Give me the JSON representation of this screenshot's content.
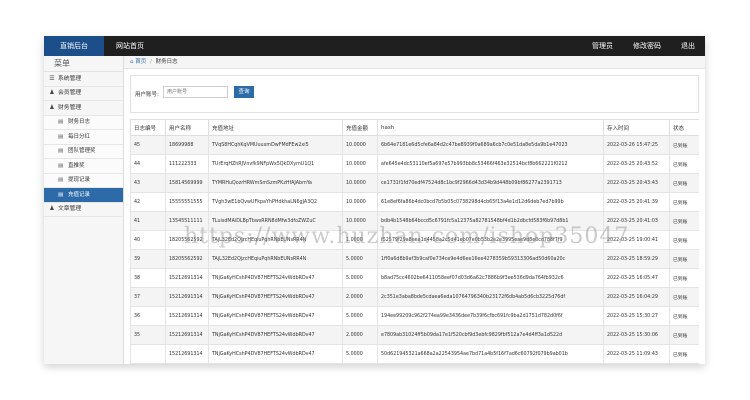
{
  "topbar": {
    "brand": "直销后台",
    "nav": "网站首页",
    "right": [
      "管理员",
      "修改密码",
      "退出"
    ]
  },
  "sidebar": {
    "title": "菜单",
    "items": [
      {
        "label": "系统管理",
        "icon": "list-icon"
      },
      {
        "label": "会员管理",
        "icon": "user-icon"
      },
      {
        "label": "财务管理",
        "icon": "user-icon"
      }
    ],
    "subitems": [
      {
        "label": "财务日志",
        "icon": "file-icon"
      },
      {
        "label": "每日分红",
        "icon": "file-icon"
      },
      {
        "label": "团队管理奖",
        "icon": "file-icon"
      },
      {
        "label": "直推奖",
        "icon": "file-icon"
      },
      {
        "label": "提现记录",
        "icon": "file-icon"
      },
      {
        "label": "充值记录",
        "icon": "file-icon",
        "active": true
      }
    ],
    "after": [
      {
        "label": "文章管理",
        "icon": "user-icon"
      }
    ]
  },
  "breadcrumb": {
    "home": "首页",
    "sep": "/",
    "current": "财务日志"
  },
  "search": {
    "label": "用户账号:",
    "placeholder": "用户账号",
    "button": "查询"
  },
  "table": {
    "headers": [
      "日志编号",
      "用户名称",
      "充值地址",
      "充值金额",
      "hash",
      "存入时间",
      "状态"
    ],
    "rows": [
      [
        "45",
        "18699988",
        "TVqS8HCqhKqVMUuuxmDwFMdFEw2xi5",
        "10.0000",
        "6b64e7181e6d5cfe6a84d2c47be8939f0a689a6cb7c0e51da8e5da9b1e47023",
        "2022-03-26 15:47:25",
        "已到账"
      ],
      [
        "44",
        "111222333",
        "TUrErqHZhRJVnvfk9NFpWx5QkDXymU1Q1",
        "10.0000",
        "afe645e4dc53110ef5a697e57b993bb8c53466f463e32514bcf8b662221f0212",
        "2022-03-25 20:43:52",
        "已到账"
      ],
      [
        "43",
        "15814569999",
        "TYMRHuQozrHRWmSmSzmPKzHfAJAbmYa",
        "10.0000",
        "ce1731f1fd70edf47524d8c1bc9f2966d43d34b9d448b09bf86277a2391713",
        "2022-03-25 20:43:43",
        "已到账"
      ],
      [
        "42",
        "15555551555",
        "TVgh3wE1bQvwUFkpaYhPHdkhaLN6gJA3Q2",
        "10.0000",
        "61e8ef6fa86b4dc0bcd7b5b05c0738298d4cb65f13a4e1d12d6deb7ed7b99b",
        "2022-03-25 20:41:39",
        "已到账"
      ],
      [
        "41",
        "13545511111",
        "TLuisdMAiDLBpTbwsRRN8dMfw3dfoZWZuC",
        "10.0000",
        "bdb4b1548b64bccd5c6791fc5a12375a82781548bf4d1b2dbcfd583f6b97d8b1",
        "2022-03-25 20:41:03",
        "已到账"
      ],
      [
        "40",
        "18205562592",
        "TAjL32Ed2QjzcHEqiuPqhRNbEUNsRR4N",
        "1.0000",
        "f52579f29a8eea1d4458a2c5d41eb07e0b53b2e2e3995eae9d8e0cd788f7f9",
        "2022-03-25 19:00:41",
        "已到账"
      ],
      [
        "39",
        "18205562592",
        "TAjL32Ed2QjzcHEqiuPqhRNbEUNsRR4N",
        "5.0000",
        "1ff0a6d8b9af3b9caf0e734ce9e4d6ee16ee4278359b59313306ad50d60a20c",
        "2022-03-25 18:59:29",
        "已到账"
      ],
      [
        "38",
        "15212691314",
        "TNjGaKyHCshP4DV87HEFTS24vWdbRDv47",
        "5.0000",
        "b8ad75cc4602be6411058eef07d03d6a62c7886b9f3ee536d9da764fb932c6",
        "2022-03-25 16:05:47",
        "已到账"
      ],
      [
        "37",
        "15212691314",
        "TNjGaKyHCshP4DV87HEFTS24vWdbRDv47",
        "2.0000",
        "2c351e3aba8bde5cdaea6eda10764796340b23172f6db4ab5d6cb3225d76df",
        "2022-03-25 16:04:29",
        "已到账"
      ],
      [
        "36",
        "15212691314",
        "TNjGaKyHCshP4DV87HEFTS24vWdbRDv47",
        "5.0000",
        "194ee99209c962f274ea99e3436dee7b39f6cfbc691fc9ba2d1751d782d0f6f",
        "2022-03-25 15:30:27",
        "已到账"
      ],
      [
        "35",
        "15212691314",
        "TNjGaKyHCshP4DV87HEFTS24vWdbRDv47",
        "2.0000",
        "e7809ab31024ff5b09da17e1f520cbf9d3ebfc9829fbf512a7e4d4ff3a1d522d",
        "2022-03-25 15:30:06",
        "已到账"
      ],
      [
        "",
        "15212691314",
        "TNjGaKyHCshP4DV87HEFTS24vWdbRDv47",
        "5.0000",
        "50d621945321a668a2a22543954ae7bd71a4b5f16f7ad6c60792f079b9ab01b",
        "2022-03-25 11:09:43",
        "已到账"
      ]
    ]
  },
  "watermark": "https://www.huzhan.com/ishop35047"
}
